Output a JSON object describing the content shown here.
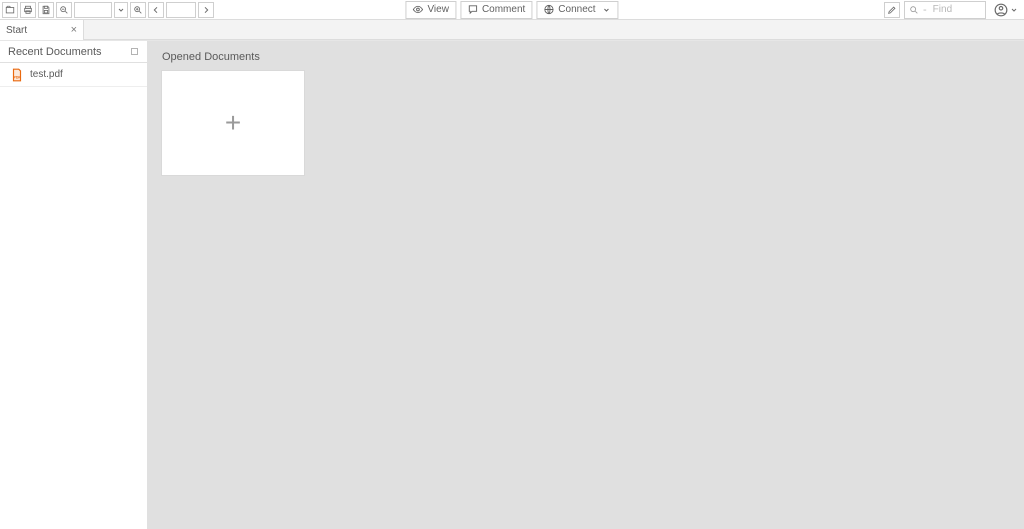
{
  "toolbar": {
    "zoom_value": "",
    "page_value": "",
    "modes": {
      "view": "View",
      "comment": "Comment",
      "connect": "Connect"
    },
    "find_placeholder": "Find"
  },
  "tabs": [
    {
      "label": "Start"
    }
  ],
  "sidebar": {
    "header": "Recent Documents",
    "items": [
      {
        "label": "test.pdf",
        "icon": "pdf-icon"
      }
    ]
  },
  "content": {
    "heading": "Opened Documents"
  }
}
